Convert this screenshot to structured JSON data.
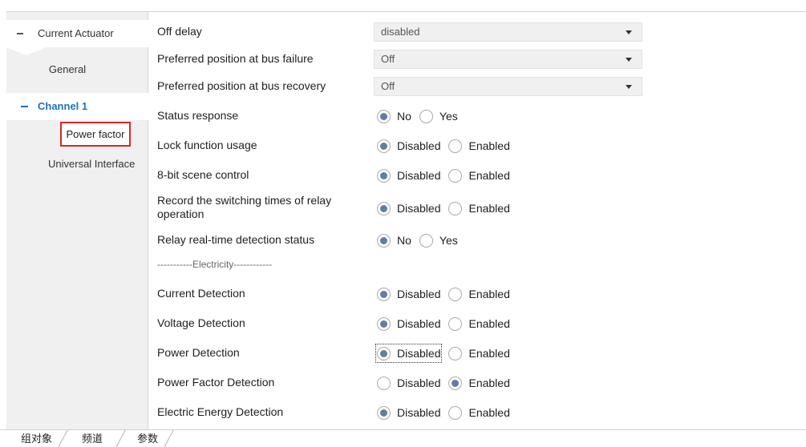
{
  "sidebar": {
    "root": "Current Actuator",
    "general": "General",
    "channel": "Channel 1",
    "power_factor": "Power factor",
    "universal": "Universal Interface"
  },
  "form": {
    "off_delay": {
      "label": "Off delay",
      "value": "disabled"
    },
    "pos_failure": {
      "label": "Preferred position at bus failure",
      "value": "Off"
    },
    "pos_recovery": {
      "label": "Preferred position at bus recovery",
      "value": "Off"
    },
    "status_response": {
      "label": "Status response",
      "opt1": "No",
      "opt2": "Yes",
      "selected": "No"
    },
    "lock_function": {
      "label": "Lock function usage",
      "opt1": "Disabled",
      "opt2": "Enabled",
      "selected": "Disabled"
    },
    "scene_control": {
      "label": "8-bit scene control",
      "opt1": "Disabled",
      "opt2": "Enabled",
      "selected": "Disabled"
    },
    "record_times": {
      "label": "Record the switching times of relay operation",
      "opt1": "Disabled",
      "opt2": "Enabled",
      "selected": "Disabled"
    },
    "relay_detection": {
      "label": "Relay real-time detection status",
      "opt1": "No",
      "opt2": "Yes",
      "selected": "No"
    },
    "separator": "-----------Electricity------------",
    "current_detection": {
      "label": "Current Detection",
      "opt1": "Disabled",
      "opt2": "Enabled",
      "selected": "Disabled"
    },
    "voltage_detection": {
      "label": "Voltage Detection",
      "opt1": "Disabled",
      "opt2": "Enabled",
      "selected": "Disabled"
    },
    "power_detection": {
      "label": "Power Detection",
      "opt1": "Disabled",
      "opt2": "Enabled",
      "selected": "Disabled"
    },
    "pf_detection": {
      "label": "Power Factor Detection",
      "opt1": "Disabled",
      "opt2": "Enabled",
      "selected": "Enabled"
    },
    "energy_detection": {
      "label": "Electric Energy Detection",
      "opt1": "Disabled",
      "opt2": "Enabled",
      "selected": "Disabled"
    }
  },
  "tabs": {
    "group_objects": "组对象",
    "channels": "频道",
    "parameters": "参数"
  },
  "colors": {
    "sidebar_bg": "#f0f0f0",
    "accent_blue": "#1e73be",
    "highlight_red": "#e02424",
    "radio_fill": "#5f7ea8"
  }
}
